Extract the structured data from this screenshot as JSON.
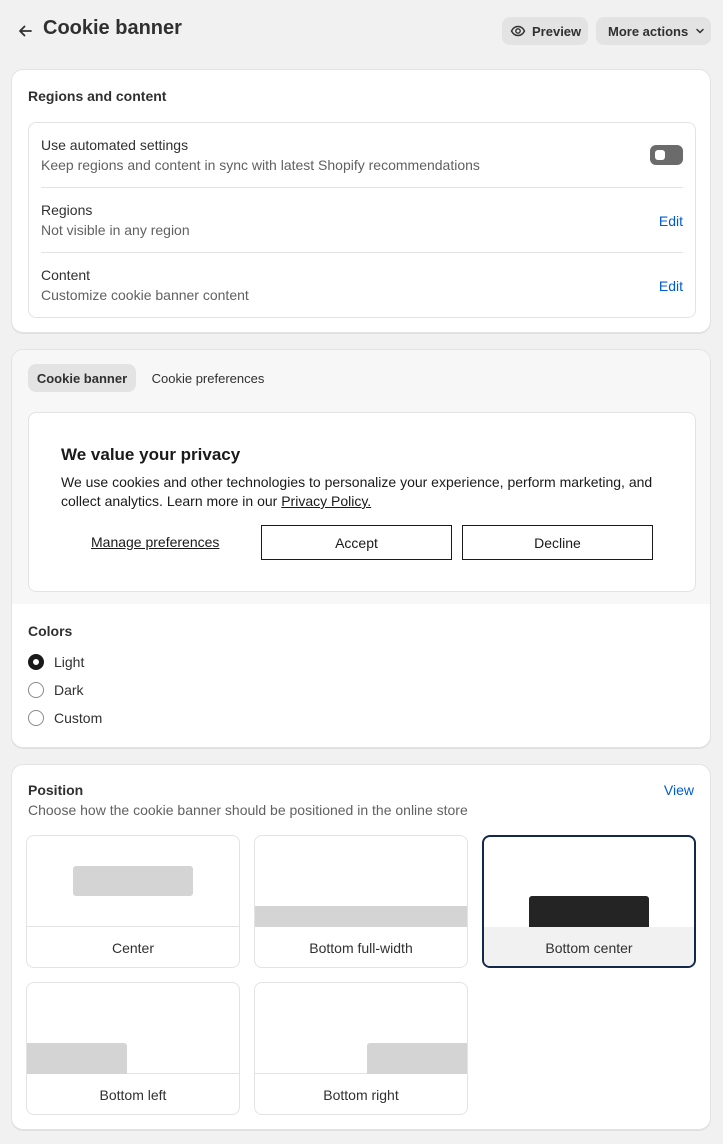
{
  "header": {
    "title": "Cookie banner",
    "preview_label": "Preview",
    "more_actions_label": "More actions"
  },
  "regions_card": {
    "title": "Regions and content",
    "rows": [
      {
        "label": "Use automated settings",
        "sub": "Keep regions and content in sync with latest Shopify recommendations",
        "toggle_on": false
      },
      {
        "label": "Regions",
        "sub": "Not visible in any region",
        "action": "Edit"
      },
      {
        "label": "Content",
        "sub": "Customize cookie banner content",
        "action": "Edit"
      }
    ]
  },
  "banner_card": {
    "tabs": [
      "Cookie banner",
      "Cookie preferences"
    ],
    "active_tab": "Cookie banner",
    "preview": {
      "title": "We value your privacy",
      "text": "We use cookies and other technologies to personalize your experience, perform marketing, and collect analytics. Learn more in our",
      "link": "Privacy Policy.",
      "manage": "Manage preferences",
      "accept": "Accept",
      "decline": "Decline"
    },
    "colors": {
      "title": "Colors",
      "options": [
        "Light",
        "Dark",
        "Custom"
      ],
      "selected": "Light"
    }
  },
  "position_card": {
    "title": "Position",
    "subtitle": "Choose how the cookie banner should be positioned in the online store",
    "view_label": "View",
    "options": [
      "Center",
      "Bottom full-width",
      "Bottom center",
      "Bottom left",
      "Bottom right"
    ],
    "selected": "Bottom center"
  },
  "colors_hex": {
    "link": "#005bd3",
    "selected_border": "#13294b",
    "dark_shape": "#242424"
  }
}
